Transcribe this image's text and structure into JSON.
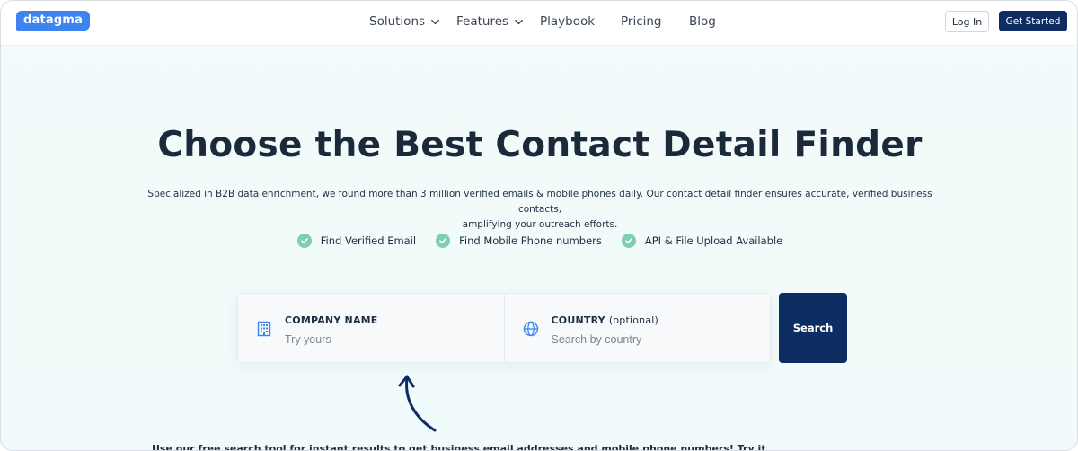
{
  "brand": {
    "logo_text": "datagma",
    "logo_color": "#3d84f0"
  },
  "nav": {
    "items": [
      {
        "label": "Solutions",
        "has_dropdown": true
      },
      {
        "label": "Features",
        "has_dropdown": true
      },
      {
        "label": "Playbook",
        "has_dropdown": false
      },
      {
        "label": "Pricing",
        "has_dropdown": false
      },
      {
        "label": "Blog",
        "has_dropdown": false
      }
    ],
    "login_label": "Log In",
    "get_started_label": "Get Started"
  },
  "hero": {
    "title": "Choose the Best Contact Detail Finder",
    "subtitle_line1": "Specialized in B2B data enrichment, we found more than 3 million verified emails & mobile phones daily. Our contact detail finder ensures accurate, verified business contacts,",
    "subtitle_line2": "amplifying your outreach efforts."
  },
  "features": [
    {
      "label": "Find Verified Email",
      "icon": "check-circle-icon"
    },
    {
      "label": "Find Mobile Phone numbers",
      "icon": "check-circle-icon"
    },
    {
      "label": "API & File Upload Available",
      "icon": "check-circle-icon"
    }
  ],
  "search": {
    "company": {
      "label": "COMPANY NAME",
      "placeholder": "Try yours",
      "value": "",
      "icon": "building-icon"
    },
    "country": {
      "label": "COUNTRY",
      "label_optional": "(optional)",
      "placeholder": "Search by country",
      "value": "",
      "icon": "globe-icon"
    },
    "button_label": "Search"
  },
  "bottom_text": "Use our free search tool for instant results to get business email addresses and mobile phone numbers! Try it",
  "colors": {
    "primary_navy": "#0d2d62",
    "accent_blue": "#3d84f0",
    "check_green": "#7fcfae",
    "background": "#f2fbfb"
  }
}
